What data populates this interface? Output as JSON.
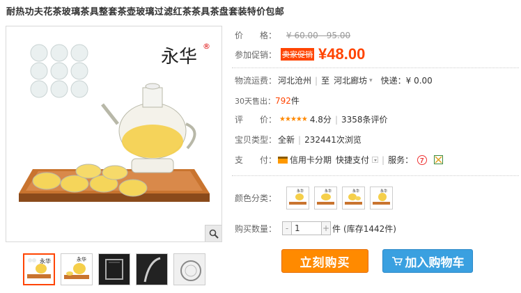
{
  "product": {
    "title": "耐热功夫花茶玻璃茶具整套茶壶玻璃过滤红茶茶具茶盘套装特价包邮",
    "brand_logo": "永华",
    "brand_reg": "®"
  },
  "price": {
    "label": "价　　格：",
    "original": "¥ 60.00 - 95.00"
  },
  "promo": {
    "label": "参加促销：",
    "tag": "卖家促销",
    "price": "¥48.00"
  },
  "shipping": {
    "label": "物流运费：",
    "from": "河北沧州",
    "to_prefix": "至",
    "to": "河北廊坊",
    "express": "快递：¥ 0.00"
  },
  "sold": {
    "label": "30天售出：",
    "count": "792",
    "unit": "件"
  },
  "rating": {
    "label": "评　　价：",
    "stars": "★★★★★",
    "score": "4.8分",
    "reviews": "3358条评价"
  },
  "item_type": {
    "label": "宝贝类型：",
    "condition": "全新",
    "views": "232441次浏览"
  },
  "payment": {
    "label": "支　　付：",
    "card": "信用卡分期",
    "quick": "快捷支付",
    "service_label": "服务：",
    "service_7": "7"
  },
  "color": {
    "label": "颜色分类："
  },
  "quantity": {
    "label": "购买数量：",
    "minus": "-",
    "value": "1",
    "plus": "+",
    "unit": "件",
    "stock": "(库存1442件)"
  },
  "buttons": {
    "buy": "立刻购买",
    "cart": "加入购物车"
  },
  "icons": {
    "zoom": "magnifier-icon",
    "cart": "cart-icon",
    "card": "credit-card-icon"
  },
  "colors": {
    "accent": "#ff4400",
    "buy_button": "#ff8a00",
    "cart_button": "#3aa0e0",
    "stars": "#ff8800"
  }
}
